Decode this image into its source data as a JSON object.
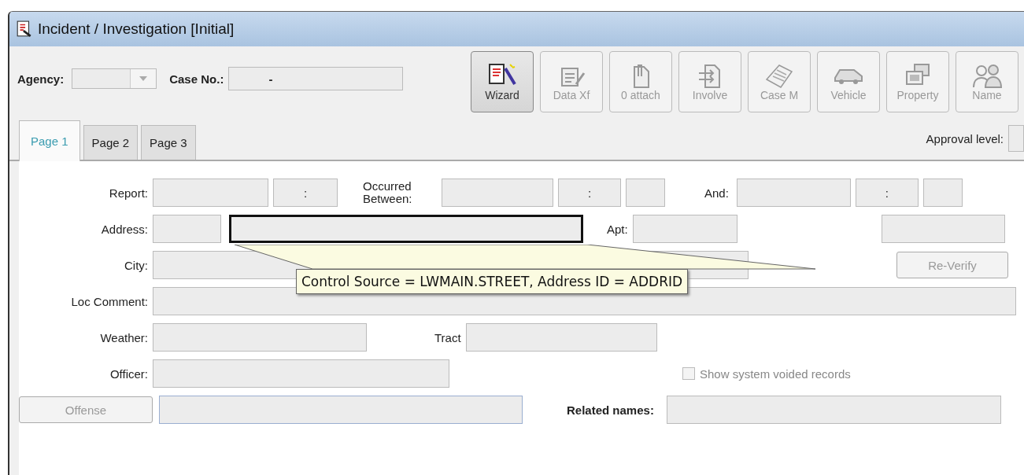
{
  "window": {
    "title": "Incident / Investigation [Initial]"
  },
  "header": {
    "agency_label": "Agency:",
    "case_label": "Case No.:",
    "case_value": "-"
  },
  "toolbar": [
    {
      "kind": "wizard",
      "label": "Wizard",
      "disabled": false
    },
    {
      "kind": "transfer",
      "label": "Data Xf",
      "disabled": true
    },
    {
      "kind": "attach",
      "label": "0 attach",
      "disabled": true
    },
    {
      "kind": "involve",
      "label": "Involve",
      "disabled": true
    },
    {
      "kind": "case",
      "label": "Case M",
      "disabled": true
    },
    {
      "kind": "vehicle",
      "label": "Vehicle",
      "disabled": true
    },
    {
      "kind": "property",
      "label": "Property",
      "disabled": true
    },
    {
      "kind": "name",
      "label": "Name",
      "disabled": true
    }
  ],
  "tabs": [
    {
      "label": "Page 1",
      "selected": true
    },
    {
      "label": "Page 2",
      "selected": false
    },
    {
      "label": "Page 3",
      "selected": false
    }
  ],
  "approval_label": "Approval level:",
  "form": {
    "report_label": "Report:",
    "report_time": ":",
    "occurred_label": "Occurred Between:",
    "occurred_time": ":",
    "and_label": "And:",
    "and_time": ":",
    "address_label": "Address:",
    "street_focused": true,
    "apt_label": "Apt:",
    "city_label": "City:",
    "reverify_button": {
      "label": "Re-Verify",
      "disabled": true
    },
    "tooltip": "Control Source = LWMAIN.STREET, Address ID = ADDRID",
    "loc_comment_label": "Loc Comment:",
    "weather_label": "Weather:",
    "tract_label": "Tract",
    "officer_label": "Officer:",
    "voided_checkbox": {
      "label": "Show system voided records",
      "checked": false,
      "disabled": true
    },
    "offense_button": {
      "label": "Offense",
      "disabled": true
    },
    "related_label": "Related names:"
  }
}
